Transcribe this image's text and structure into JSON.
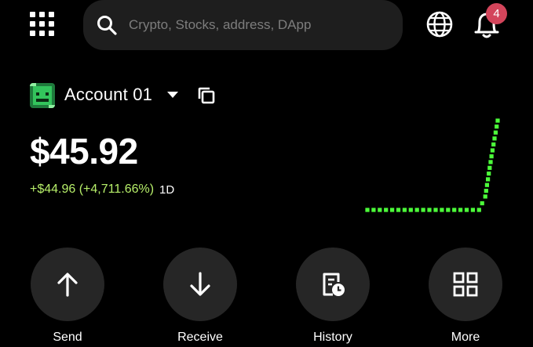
{
  "header": {
    "menu_icon": "grid-dots-icon",
    "search_placeholder": "Crypto, Stocks, address, DApp",
    "globe_icon": "globe-icon",
    "bell_icon": "bell-icon",
    "notification_count": "4",
    "badge_color": "#d3455b"
  },
  "account": {
    "name": "Account 01",
    "balance": "$45.92",
    "change": "+$44.96 (+4,711.66%)",
    "period": "1D",
    "change_color": "#b7ef6a"
  },
  "chart_data": {
    "type": "line",
    "title": "",
    "note": "sparkline, no axes",
    "x": [
      0,
      1,
      2,
      3,
      4,
      5,
      6,
      7,
      8,
      9,
      10,
      11,
      12,
      13,
      14,
      15,
      16,
      17,
      18,
      19,
      20,
      21
    ],
    "values": [
      0,
      0,
      0,
      0,
      0,
      0,
      0,
      0,
      0,
      0,
      0,
      0,
      0,
      0,
      0,
      0,
      0,
      0,
      0,
      0.15,
      0.6,
      1.0
    ],
    "color": "#4cff3a"
  },
  "actions": [
    {
      "label": "Send",
      "icon": "arrow-up-icon"
    },
    {
      "label": "Receive",
      "icon": "arrow-down-icon"
    },
    {
      "label": "History",
      "icon": "history-icon"
    },
    {
      "label": "More",
      "icon": "more-grid-icon"
    }
  ]
}
